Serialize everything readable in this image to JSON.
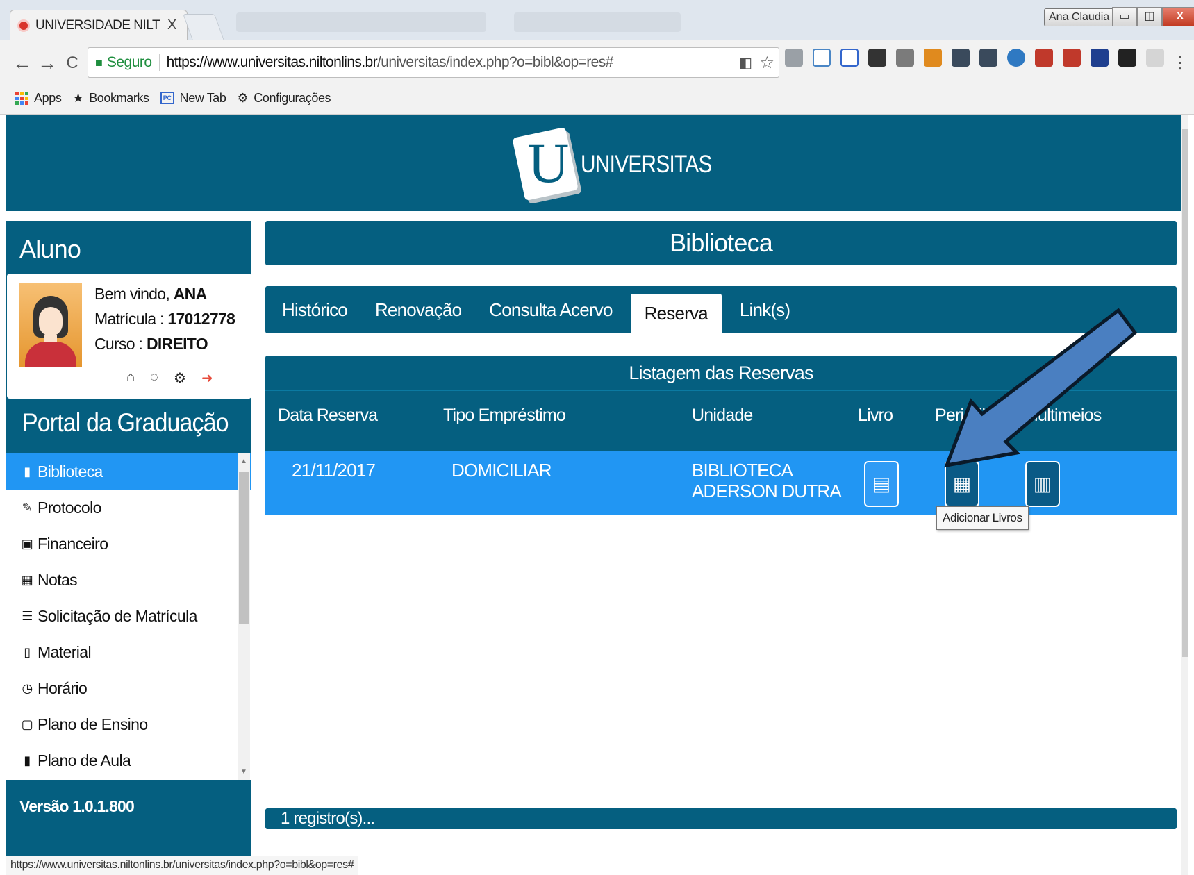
{
  "browser": {
    "tab_title": "UNIVERSIDADE NILTON",
    "tab_close": "X",
    "window_user": "Ana Claudia",
    "win_min": "▭",
    "win_max": "◫",
    "win_close": "X",
    "secure_label": "Seguro",
    "url_host": "https://www.universitas.niltonlins.br",
    "url_path": "/universitas/index.php?o=bibl&op=res#",
    "bookmarks": [
      {
        "label": "Apps",
        "icon": "apps-grid-icon"
      },
      {
        "label": "Bookmarks",
        "icon": "star-icon"
      },
      {
        "label": "New Tab",
        "icon": "pc-icon"
      },
      {
        "label": "Configurações",
        "icon": "gear-icon"
      }
    ],
    "status_url": "https://www.universitas.niltonlins.br/universitas/index.php?o=bibl&op=res#"
  },
  "header": {
    "logo_letter": "U",
    "logo_text": "UNIVERSITAS"
  },
  "sidebar": {
    "title": "Aluno",
    "welcome_prefix": "Bem vindo,",
    "welcome_name": "ANA",
    "matricula_label": "Matrícula :",
    "matricula_value": "17012778",
    "curso_label": "Curso :",
    "curso_value": "DIREITO",
    "portal_title": "Portal da Graduação",
    "menu": [
      {
        "label": "Biblioteca",
        "icon": "book-icon",
        "glyph": "▮",
        "active": true
      },
      {
        "label": "Protocolo",
        "icon": "edit-icon",
        "glyph": "✎",
        "active": false
      },
      {
        "label": "Financeiro",
        "icon": "money-icon",
        "glyph": "▣",
        "active": false
      },
      {
        "label": "Notas",
        "icon": "table-icon",
        "glyph": "▦",
        "active": false
      },
      {
        "label": "Solicitação de Matrícula",
        "icon": "list-icon",
        "glyph": "☰",
        "active": false
      },
      {
        "label": "Material",
        "icon": "file-icon",
        "glyph": "▯",
        "active": false
      },
      {
        "label": "Horário",
        "icon": "clock-icon",
        "glyph": "◷",
        "active": false
      },
      {
        "label": "Plano de Ensino",
        "icon": "document-icon",
        "glyph": "▢",
        "active": false
      },
      {
        "label": "Plano de Aula",
        "icon": "bookmark-icon",
        "glyph": "▮",
        "active": false
      }
    ],
    "version": "Versão 1.0.1.800"
  },
  "main": {
    "title": "Biblioteca",
    "tabs": [
      {
        "label": "Histórico",
        "active": false
      },
      {
        "label": "Renovação",
        "active": false
      },
      {
        "label": "Consulta Acervo",
        "active": false
      },
      {
        "label": "Reserva",
        "active": true
      },
      {
        "label": "Link(s)",
        "active": false
      }
    ],
    "list_title": "Listagem das Reservas",
    "columns": [
      "Data Reserva",
      "Tipo Empréstimo",
      "Unidade",
      "Livro",
      "Periódico",
      "Multimeios"
    ],
    "rows": [
      {
        "data": "21/11/2017",
        "tipo": "DOMICILIAR",
        "unidade_l1": "BIBLIOTECA",
        "unidade_l2": "ADERSON DUTRA"
      }
    ],
    "tooltip": "Adicionar Livros",
    "footer": "1 registro(s)..."
  },
  "colors": {
    "header": "#055f80",
    "active_blue": "#2196f3",
    "arrow_fill": "#4a7fc1"
  }
}
